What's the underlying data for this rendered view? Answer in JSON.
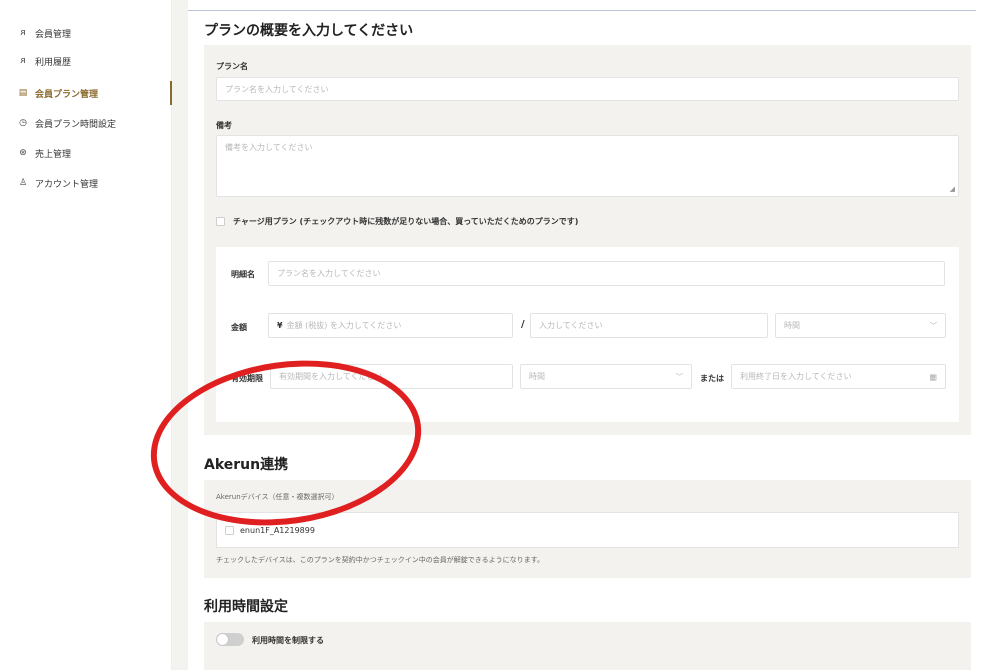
{
  "sidebar": {
    "items": [
      {
        "label": "会員管理",
        "icon": "users-icon"
      },
      {
        "label": "利用履歴",
        "icon": "history-icon"
      },
      {
        "label": "会員プラン管理",
        "icon": "plan-icon",
        "active": true
      },
      {
        "label": "会員プラン時間設定",
        "icon": "clock-icon"
      },
      {
        "label": "売上管理",
        "icon": "sales-icon"
      },
      {
        "label": "アカウント管理",
        "icon": "account-icon"
      }
    ]
  },
  "plan_section": {
    "title": "プランの概要を入力してください",
    "plan_name_label": "プラン名",
    "plan_name_placeholder": "プラン名を入力してください",
    "remarks_label": "備考",
    "remarks_placeholder": "備考を入力してください",
    "charge_checkbox_label": "チャージ用プラン (チェックアウト時に残数が足りない場合、買っていただくためのプランです)"
  },
  "detail": {
    "item_label": "明細名",
    "item_placeholder": "プラン名を入力してください",
    "price_label": "金額",
    "currency": "¥",
    "price_placeholder": "金額 (税抜) を入力してください",
    "slash": "/",
    "per_placeholder": "入力してください",
    "unit_placeholder": "時間",
    "validity_label": "有効期限",
    "validity_placeholder": "有効期間を入力してください",
    "validity_unit": "時間",
    "or_label": "または",
    "end_date_placeholder": "利用終了日を入力してください"
  },
  "akerun": {
    "title": "Akerun連携",
    "devices_label": "Akerunデバイス（任意・複数選択可）",
    "device_name": "enun1F_A1219899",
    "note": "チェックしたデバイスは、このプランを契約中かつチェックイン中の会員が解錠できるようになります。"
  },
  "usage_time": {
    "title": "利用時間設定",
    "toggle_label": "利用時間を制限する",
    "toggle_on": false
  },
  "colors": {
    "accent": "#8b6a2c",
    "panel": "#f3f2ee",
    "annotation": "#e02020"
  }
}
